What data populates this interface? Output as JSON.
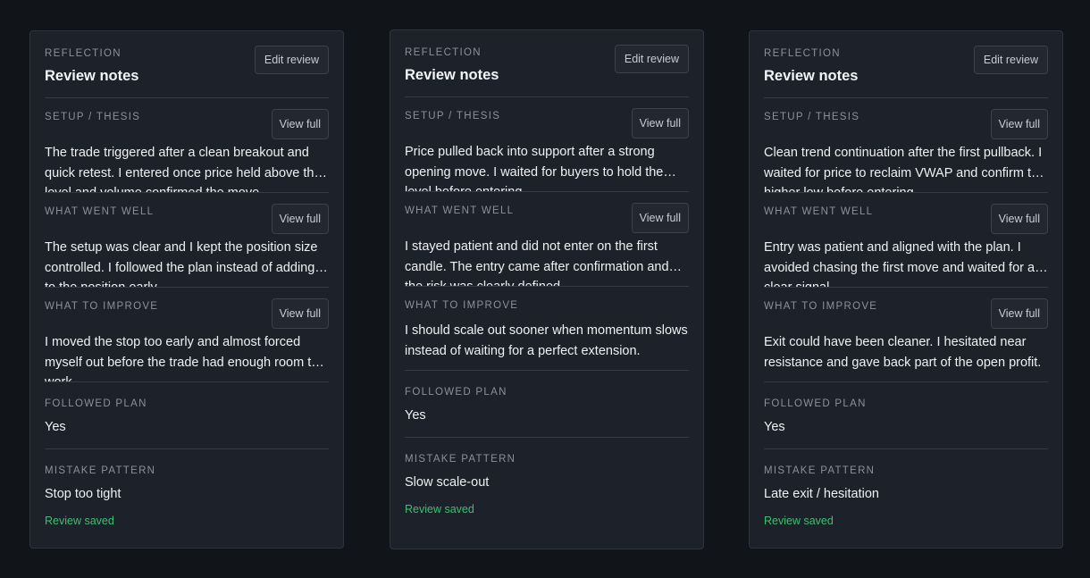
{
  "cards": [
    {
      "eyebrow": "REFLECTION",
      "title": "Review notes",
      "edit_label": "Edit review",
      "sections": [
        {
          "label": "SETUP / THESIS",
          "view_label": "View full",
          "text": "The trade triggered after a clean breakout and quick retest. I entered once price held above the level and volume confirmed the move."
        },
        {
          "label": "WHAT WENT WELL",
          "view_label": "View full",
          "text": "The setup was clear and I kept the position size controlled. I followed the plan instead of adding to the position early."
        },
        {
          "label": "WHAT TO IMPROVE",
          "view_label": "View full",
          "text": "I moved the stop too early and almost forced myself out before the trade had enough room to work."
        }
      ],
      "followed_plan_label": "FOLLOWED PLAN",
      "followed_plan_value": "Yes",
      "mistake_label": "MISTAKE PATTERN",
      "mistake_value": "Stop too tight",
      "status": "Review saved"
    },
    {
      "eyebrow": "REFLECTION",
      "title": "Review notes",
      "edit_label": "Edit review",
      "sections": [
        {
          "label": "SETUP / THESIS",
          "view_label": "View full",
          "text": "Price pulled back into support after a strong opening move. I waited for buyers to hold the level before entering."
        },
        {
          "label": "WHAT WENT WELL",
          "view_label": "View full",
          "text": "I stayed patient and did not enter on the first candle. The entry came after confirmation and the risk was clearly defined."
        },
        {
          "label": "WHAT TO IMPROVE",
          "view_label": "",
          "text": "I should scale out sooner when momentum slows instead of waiting for a perfect extension."
        }
      ],
      "followed_plan_label": "FOLLOWED PLAN",
      "followed_plan_value": "Yes",
      "mistake_label": "MISTAKE PATTERN",
      "mistake_value": "Slow scale-out",
      "status": "Review saved"
    },
    {
      "eyebrow": "REFLECTION",
      "title": "Review notes",
      "edit_label": "Edit review",
      "sections": [
        {
          "label": "SETUP / THESIS",
          "view_label": "View full",
          "text": "Clean trend continuation after the first pullback. I waited for price to reclaim VWAP and confirm the higher low before entering."
        },
        {
          "label": "WHAT WENT WELL",
          "view_label": "View full",
          "text": "Entry was patient and aligned with the plan. I avoided chasing the first move and waited for a clear signal."
        },
        {
          "label": "WHAT TO IMPROVE",
          "view_label": "View full",
          "text": "Exit could have been cleaner. I hesitated near resistance and gave back part of the open profit."
        }
      ],
      "followed_plan_label": "FOLLOWED PLAN",
      "followed_plan_value": "Yes",
      "mistake_label": "MISTAKE PATTERN",
      "mistake_value": "Late exit / hesitation",
      "status": "Review saved"
    }
  ]
}
